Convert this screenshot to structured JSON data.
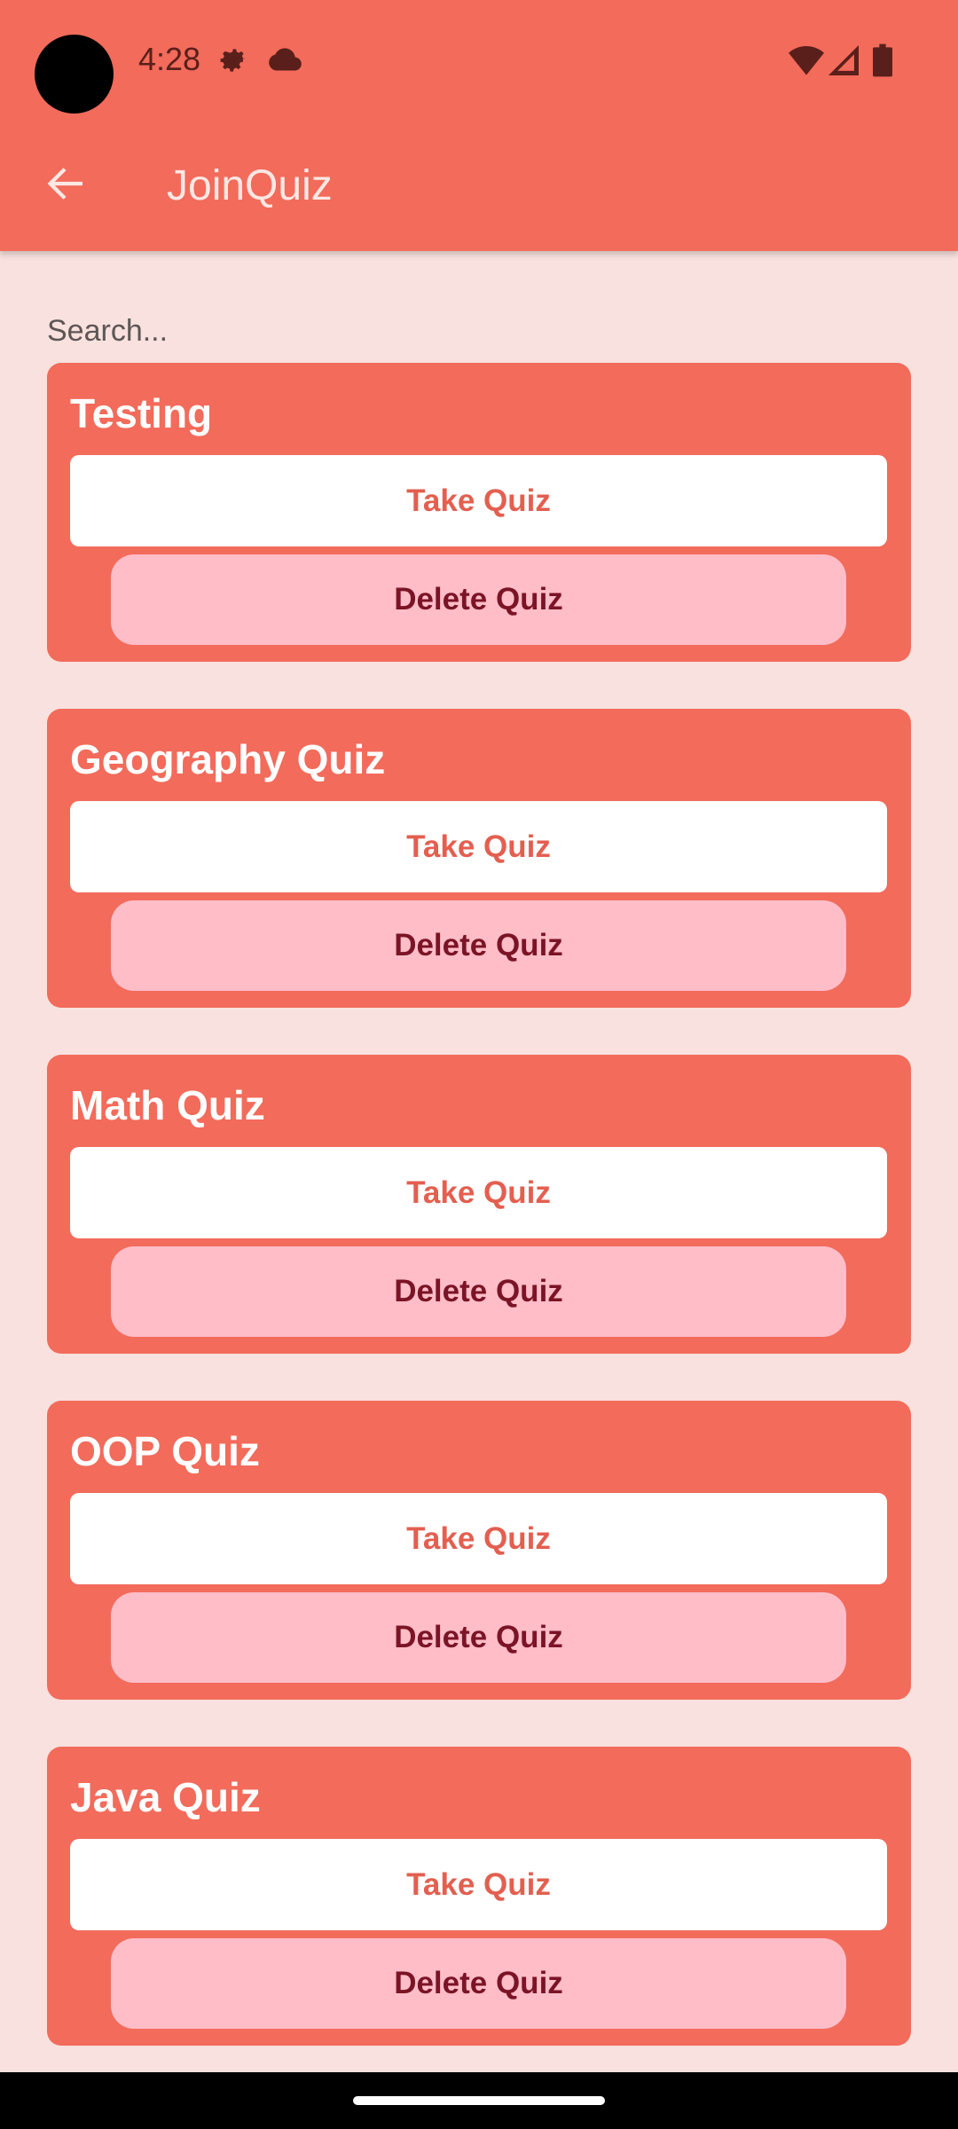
{
  "status_bar": {
    "time": "4:28",
    "icons": [
      "settings-gear-icon",
      "cloud-icon",
      "wifi-icon",
      "signal-icon",
      "battery-icon"
    ]
  },
  "app_bar": {
    "title": "JoinQuiz",
    "back_icon": "arrow-back-icon"
  },
  "search": {
    "placeholder": "Search...",
    "value": ""
  },
  "quizzes": [
    {
      "title": "Testing",
      "take_label": "Take Quiz",
      "delete_label": "Delete Quiz"
    },
    {
      "title": "Geography Quiz",
      "take_label": "Take Quiz",
      "delete_label": "Delete Quiz"
    },
    {
      "title": "Math Quiz",
      "take_label": "Take Quiz",
      "delete_label": "Delete Quiz"
    },
    {
      "title": "OOP Quiz",
      "take_label": "Take Quiz",
      "delete_label": "Delete Quiz"
    },
    {
      "title": "Java Quiz",
      "take_label": "Take Quiz",
      "delete_label": "Delete Quiz"
    }
  ],
  "colors": {
    "primary": "#F26B5B",
    "background": "#F8E1DE",
    "take_text": "#E35F50",
    "delete_bg": "#FFBDC8",
    "delete_text": "#7B1426"
  }
}
